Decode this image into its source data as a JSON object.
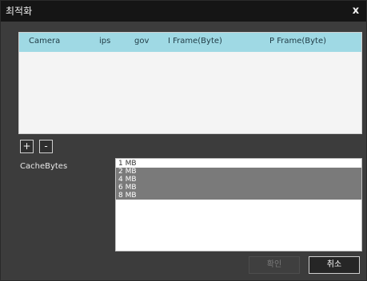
{
  "window": {
    "title": "최적화",
    "close_glyph": "x"
  },
  "stream_table": {
    "columns": [
      "Camera",
      "ips",
      "gov",
      "I Frame(Byte)",
      "P Frame(Byte)"
    ],
    "rows": []
  },
  "controls": {
    "add_label": "+",
    "remove_label": "-"
  },
  "cache": {
    "label": "CacheBytes",
    "options": [
      "1 MB",
      "2 MB",
      "4 MB",
      "6 MB",
      "8 MB"
    ],
    "selected": [
      "2 MB",
      "4 MB",
      "6 MB",
      "8 MB"
    ]
  },
  "footer": {
    "ok_label": "확인",
    "cancel_label": "취소"
  },
  "colors": {
    "header_bg": "#9fd9e4",
    "selection_bg": "#7a7a7a",
    "dialog_bg": "#3c3c3c",
    "titlebar_bg": "#151515"
  }
}
